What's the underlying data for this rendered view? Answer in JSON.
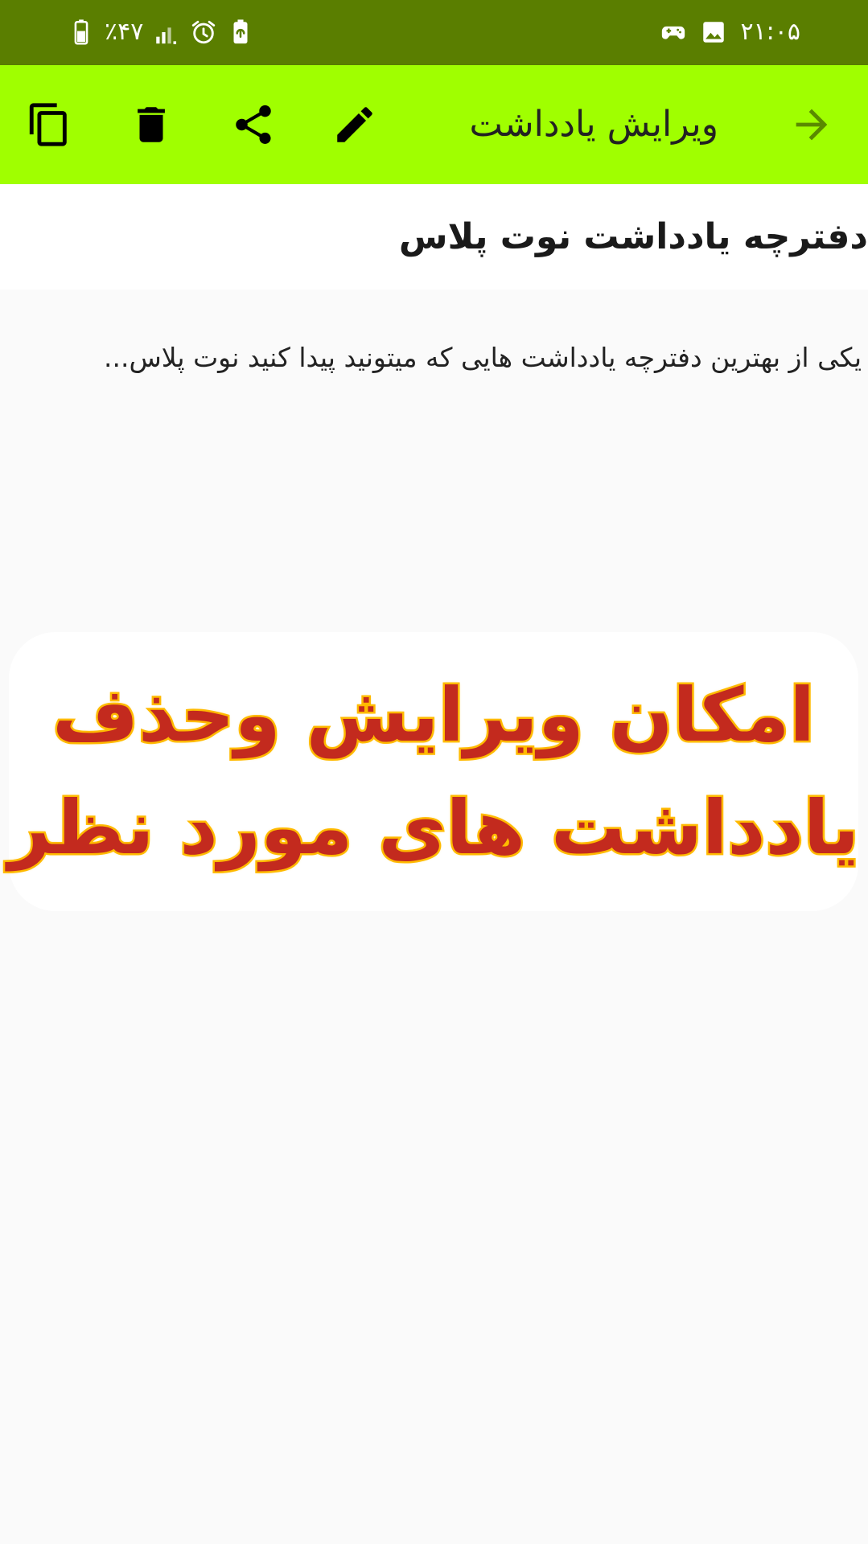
{
  "status_bar": {
    "time": "۲۱:۰۵",
    "battery": "٪۴۷",
    "icons": [
      "gamepad-icon",
      "image-icon",
      "signal-icon",
      "alarm-icon",
      "battery-saver-icon",
      "battery-icon"
    ]
  },
  "toolbar": {
    "title": "ویرایش یادداشت",
    "icons": {
      "back": "arrow-back-icon",
      "edit": "edit-pencil-icon",
      "share": "share-icon",
      "delete": "delete-trash-icon",
      "copy": "copy-icon"
    },
    "colors": {
      "background": "#a0ff00",
      "status_bar": "#5a7e00",
      "back_arrow": "#5a8a00"
    }
  },
  "note": {
    "title": "دفترچه یادداشت نوت پلاس",
    "body": "یکی از بهترین دفترچه یادداشت هایی که میتونید پیدا کنید نوت پلاس..."
  },
  "banner": {
    "line1": "امکان ویرایش وحذف",
    "line2": "یادداشت های مورد نظر",
    "colors": {
      "text": "#c32a1e",
      "outline": "#ffba00"
    }
  }
}
